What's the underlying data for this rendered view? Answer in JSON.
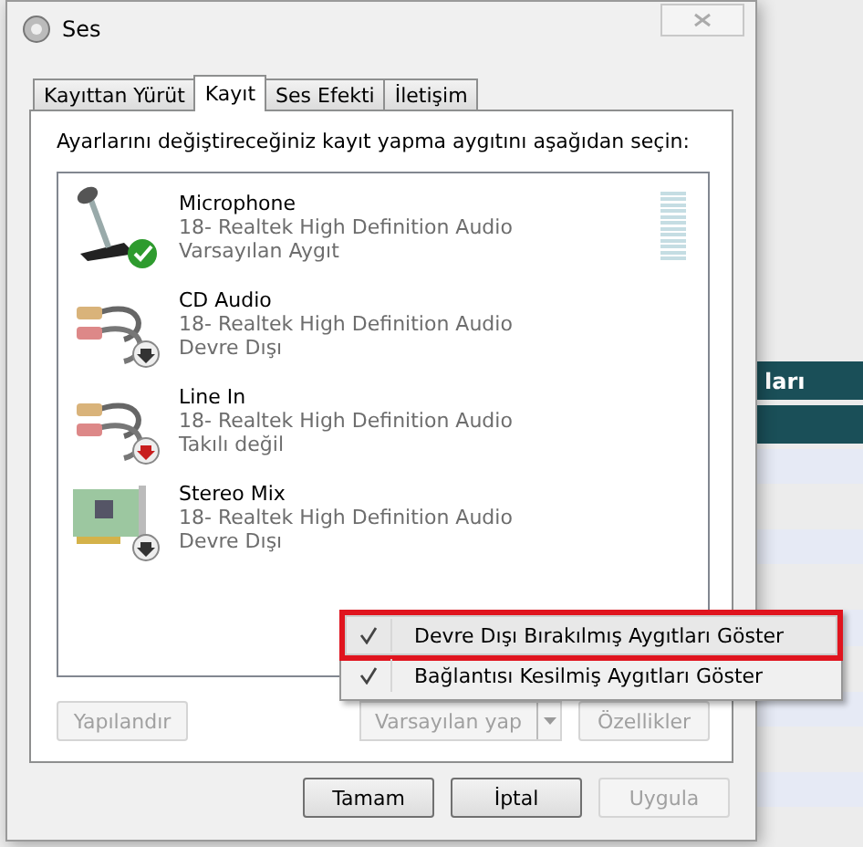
{
  "window": {
    "title": "Ses"
  },
  "tabs": [
    {
      "label": "Kayıttan Yürüt",
      "selected": false
    },
    {
      "label": "Kayıt",
      "selected": true
    },
    {
      "label": "Ses Efekti",
      "selected": false
    },
    {
      "label": "İletişim",
      "selected": false
    }
  ],
  "instruction": "Ayarlarını değiştireceğiniz kayıt yapma aygıtını aşağıdan seçin:",
  "devices": [
    {
      "name": "Microphone",
      "driver": "18- Realtek High Definition Audio",
      "status": "Varsayılan Aygıt",
      "kind": "mic",
      "badge": {
        "kind": "check"
      },
      "level": 0
    },
    {
      "name": "CD Audio",
      "driver": "18- Realtek High Definition Audio",
      "status": "Devre Dışı",
      "kind": "cable",
      "badge": {
        "kind": "down"
      }
    },
    {
      "name": "Line In",
      "driver": "18- Realtek High Definition Audio",
      "status": "Takılı değil",
      "kind": "cable",
      "badge": {
        "kind": "down-red"
      }
    },
    {
      "name": "Stereo Mix",
      "driver": "18- Realtek High Definition Audio",
      "status": "Devre Dışı",
      "kind": "card",
      "badge": {
        "kind": "down"
      }
    }
  ],
  "panel_buttons": [
    {
      "label": "Yapılandır",
      "disabled": true,
      "kind": "plain"
    },
    {
      "label": "Varsayılan yap",
      "disabled": true,
      "kind": "split"
    },
    {
      "label": "Özellikler",
      "disabled": true,
      "kind": "plain"
    }
  ],
  "dialog_buttons": [
    {
      "label": "Tamam",
      "disabled": false
    },
    {
      "label": "İptal",
      "disabled": false
    },
    {
      "label": "Uygula",
      "disabled": true
    }
  ],
  "context_menu": [
    {
      "label": "Devre Dışı Bırakılmış Aygıtları Göster",
      "checked": true,
      "highlighted": true
    },
    {
      "label": "Bağlantısı Kesilmiş Aygıtları Göster",
      "checked": true,
      "highlighted": false
    }
  ],
  "background": {
    "heading": "ları"
  }
}
